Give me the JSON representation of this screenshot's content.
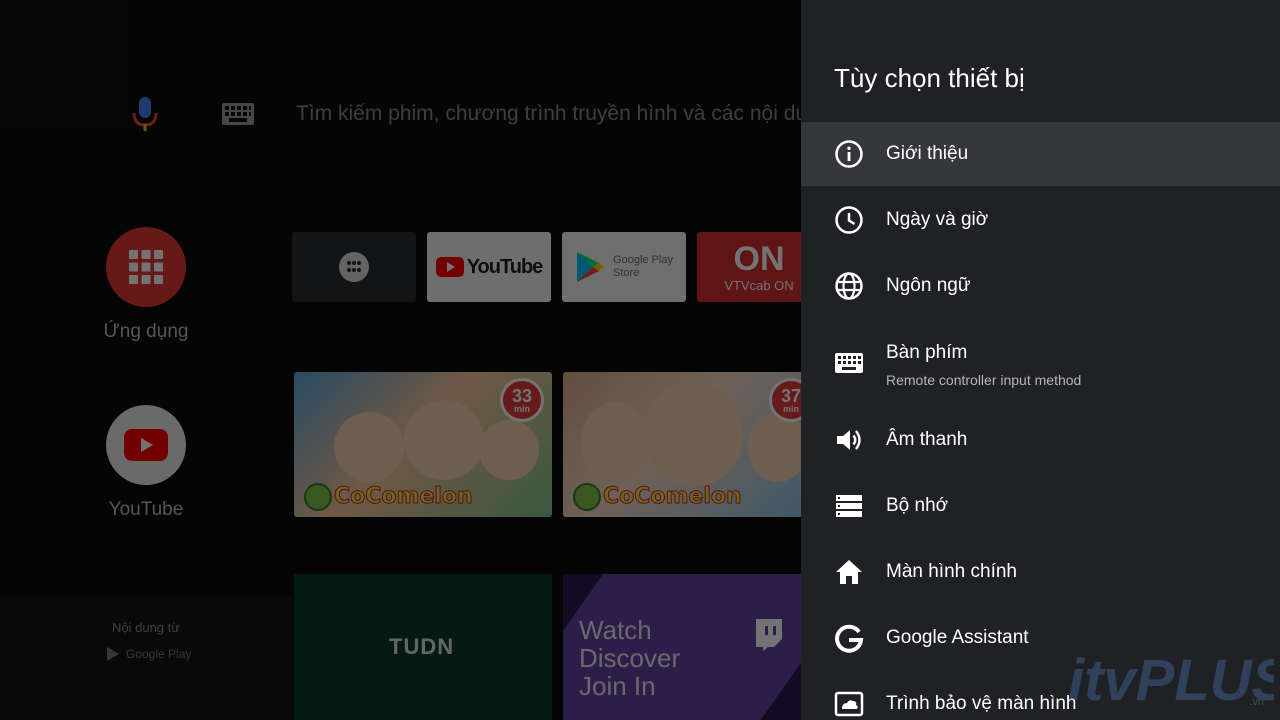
{
  "search": {
    "placeholder_text": "Tìm kiếm phim, chương trình truyền hình và các nội du"
  },
  "sidebar": {
    "apps_label": "Ứng dụng",
    "youtube_label": "YouTube",
    "content_from_label": "Nội dung từ",
    "content_from_source": "Google Play"
  },
  "app_row": {
    "youtube_logo_text": "YouTube",
    "play_store_text_1": "Google Play",
    "play_store_text_2": "Store",
    "vtvcab_logo_text": "ON",
    "vtvcab_label": "VTVcab ON"
  },
  "videos": [
    {
      "duration_number": "33",
      "duration_unit": "min",
      "brand": "CoComelon"
    },
    {
      "duration_number": "37",
      "duration_unit": "min",
      "brand": "CoComelon"
    }
  ],
  "bottom_tiles": {
    "tudn_text": "TUDN",
    "watch_text": [
      "Watch",
      "Discover",
      "Join In"
    ]
  },
  "settings_panel": {
    "title": "Tùy chọn thiết bị",
    "items": [
      {
        "label": "Giới thiệu",
        "icon": "info-icon"
      },
      {
        "label": "Ngày và giờ",
        "icon": "clock-icon"
      },
      {
        "label": "Ngôn ngữ",
        "icon": "globe-icon"
      },
      {
        "label": "Bàn phím",
        "sublabel": "Remote controller input method",
        "icon": "keyboard-icon"
      },
      {
        "label": "Âm thanh",
        "icon": "speaker-icon"
      },
      {
        "label": "Bộ nhớ",
        "icon": "storage-icon"
      },
      {
        "label": "Màn hình chính",
        "icon": "home-icon"
      },
      {
        "label": "Google Assistant",
        "icon": "google-g-icon"
      },
      {
        "label": "Trình bảo vệ màn hình",
        "icon": "screensaver-icon"
      }
    ]
  },
  "watermark": {
    "text": "itvPLUS",
    "suffix": ".vn"
  },
  "colors": {
    "panel_bg": "#202124",
    "focused_row_bg": "#36373a",
    "apps_button_red": "#e53935",
    "youtube_red": "#ff0000"
  }
}
